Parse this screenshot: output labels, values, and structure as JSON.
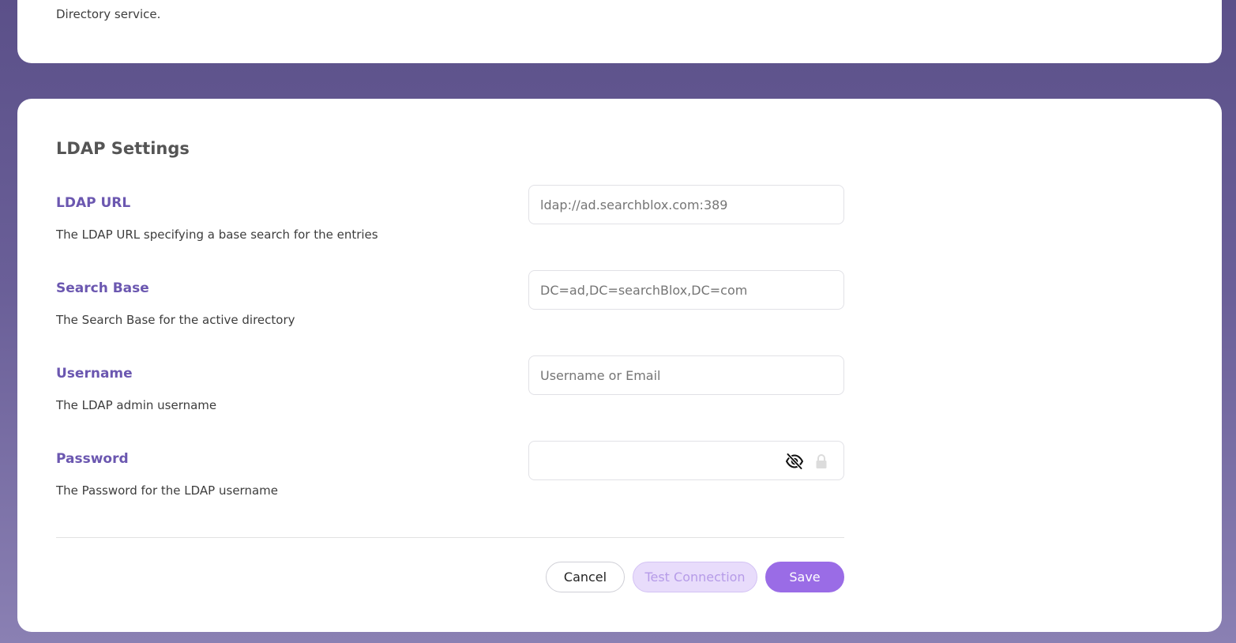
{
  "top_card": {
    "description_tail": "Directory service."
  },
  "ldap": {
    "title": "LDAP Settings",
    "fields": [
      {
        "label": "LDAP URL",
        "help": "The LDAP URL specifying a base search for the entries",
        "value": "",
        "placeholder": "ldap://ad.searchblox.com:389"
      },
      {
        "label": "Search Base",
        "help": "The Search Base for the active directory",
        "value": "",
        "placeholder": "DC=ad,DC=searchBlox,DC=com"
      },
      {
        "label": "Username",
        "help": "The LDAP admin username",
        "value": "",
        "placeholder": "Username or Email"
      },
      {
        "label": "Password",
        "help": "The Password for the LDAP username",
        "value": "",
        "placeholder": ""
      }
    ]
  },
  "buttons": {
    "cancel": "Cancel",
    "test_connection": "Test Connection",
    "save": "Save"
  },
  "icons": {
    "password_toggle": "eye-slash-icon",
    "password_manager": "lock-icon"
  },
  "colors": {
    "label": "#6b57b0",
    "save_button": "#9a6ce6",
    "test_button_bg": "#e8dcfb",
    "test_button_text": "#b69be8"
  }
}
